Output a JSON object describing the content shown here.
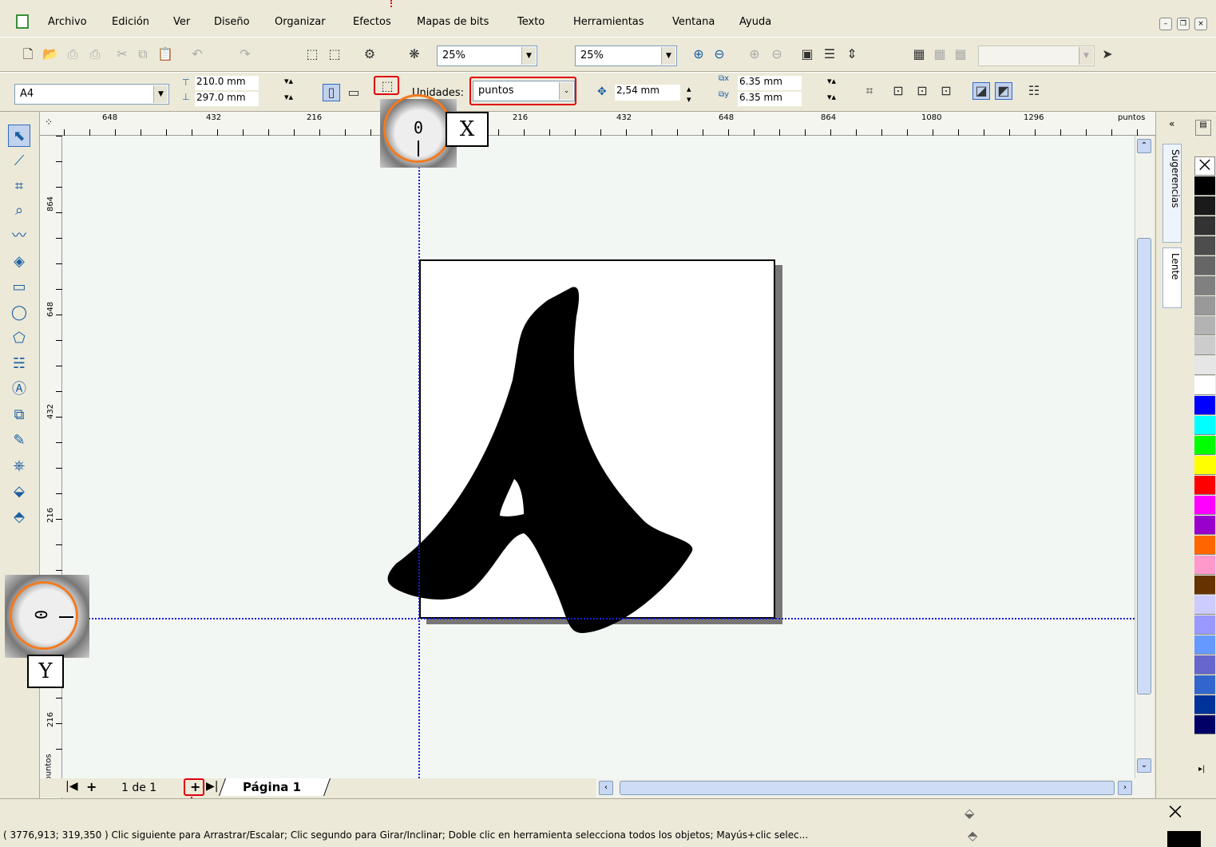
{
  "menu": {
    "items": [
      "Archivo",
      "Edición",
      "Ver",
      "Diseño",
      "Organizar",
      "Efectos",
      "Mapas de bits",
      "Texto",
      "Herramientas",
      "Ventana",
      "Ayuda"
    ]
  },
  "standard_toolbar": {
    "zoom_left": "25%",
    "zoom_right": "25%"
  },
  "property_bar": {
    "paper_size": "A4",
    "width": "210.0 mm",
    "height": "297.0 mm",
    "units_label": "Unidades:",
    "units_value": "puntos",
    "nudge": "2,54 mm",
    "dup_x": "6.35 mm",
    "dup_y": "6.35 mm"
  },
  "ruler": {
    "unit": "puntos",
    "h_labels": [
      "648",
      "432",
      "216",
      "0",
      "216",
      "432",
      "648",
      "864",
      "1080",
      "1296"
    ],
    "v_labels": [
      "864",
      "648",
      "432",
      "216",
      "0",
      "216"
    ]
  },
  "callouts": {
    "x_zero": "0",
    "x_label": "X",
    "y_zero": "0",
    "y_label": "Y"
  },
  "page_tabs": {
    "counter": "1 de 1",
    "page_name": "Página 1"
  },
  "dockers": {
    "tab1": "Sugerencias",
    "tab2": "Lente"
  },
  "palette": [
    "#ffffff",
    "#000000",
    "#1a1a1a",
    "#333333",
    "#4d4d4d",
    "#666666",
    "#808080",
    "#999999",
    "#b3b3b3",
    "#cccccc",
    "#e6e6e6",
    "#ffffff",
    "#0000ff",
    "#00ffff",
    "#00ff00",
    "#ffff00",
    "#ff0000",
    "#ff00ff",
    "#9900cc",
    "#ff6600",
    "#ff99cc",
    "#663300",
    "#ccccff",
    "#9999ff",
    "#6699ff",
    "#6666cc",
    "#3366cc",
    "#003399",
    "#000066"
  ],
  "status": {
    "text": "( 3776,913; 319,350 )  Clic siguiente para Arrastrar/Escalar; Clic segundo para Girar/Inclinar; Doble clic en herramienta selecciona todos los objetos; Mayús+clic selec..."
  }
}
